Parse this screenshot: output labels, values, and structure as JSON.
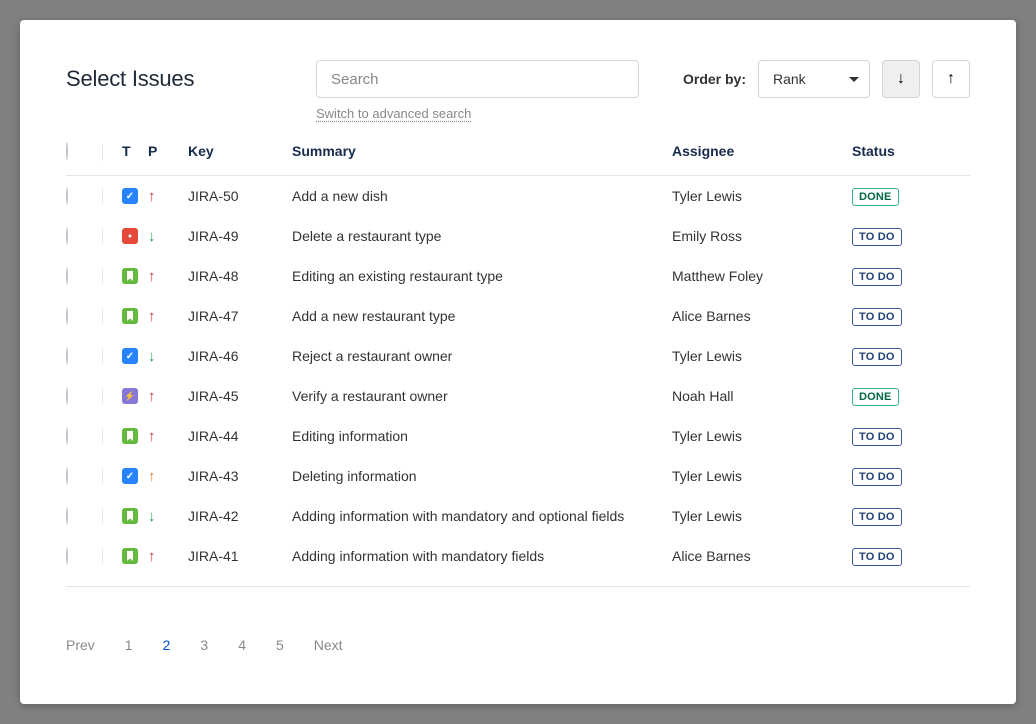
{
  "title": "Select Issues",
  "search": {
    "placeholder": "Search",
    "advanced_link": "Switch to advanced search"
  },
  "orderby": {
    "label": "Order by:",
    "value": "Rank"
  },
  "columns": {
    "t": "T",
    "p": "P",
    "key": "Key",
    "summary": "Summary",
    "assignee": "Assignee",
    "status": "Status"
  },
  "statuses": {
    "done": "DONE",
    "todo": "TO DO"
  },
  "issues": [
    {
      "type": "task",
      "priority": "high",
      "key": "JIRA-50",
      "summary": "Add a new dish",
      "assignee": "Tyler Lewis",
      "status": "done"
    },
    {
      "type": "bug",
      "priority": "low",
      "key": "JIRA-49",
      "summary": "Delete a restaurant type",
      "assignee": "Emily Ross",
      "status": "todo"
    },
    {
      "type": "story",
      "priority": "high",
      "key": "JIRA-48",
      "summary": "Editing an existing restaurant type",
      "assignee": "Matthew Foley",
      "status": "todo"
    },
    {
      "type": "story",
      "priority": "high",
      "key": "JIRA-47",
      "summary": "Add a new restaurant type",
      "assignee": "Alice Barnes",
      "status": "todo"
    },
    {
      "type": "task",
      "priority": "low",
      "key": "JIRA-46",
      "summary": "Reject a restaurant owner",
      "assignee": "Tyler Lewis",
      "status": "todo"
    },
    {
      "type": "epic",
      "priority": "high",
      "key": "JIRA-45",
      "summary": "Verify a restaurant owner",
      "assignee": "Noah Hall",
      "status": "done"
    },
    {
      "type": "story",
      "priority": "high",
      "key": "JIRA-44",
      "summary": "Editing information",
      "assignee": "Tyler Lewis",
      "status": "todo"
    },
    {
      "type": "task",
      "priority": "med",
      "key": "JIRA-43",
      "summary": "Deleting information",
      "assignee": "Tyler Lewis",
      "status": "todo"
    },
    {
      "type": "story",
      "priority": "low",
      "key": "JIRA-42",
      "summary": "Adding information with mandatory and optional fields",
      "assignee": "Tyler Lewis",
      "status": "todo"
    },
    {
      "type": "story",
      "priority": "high",
      "key": "JIRA-41",
      "summary": "Adding information with mandatory fields",
      "assignee": "Alice Barnes",
      "status": "todo"
    }
  ],
  "pagination": {
    "prev": "Prev",
    "pages": [
      "1",
      "2",
      "3",
      "4",
      "5"
    ],
    "active": "2",
    "next": "Next"
  }
}
